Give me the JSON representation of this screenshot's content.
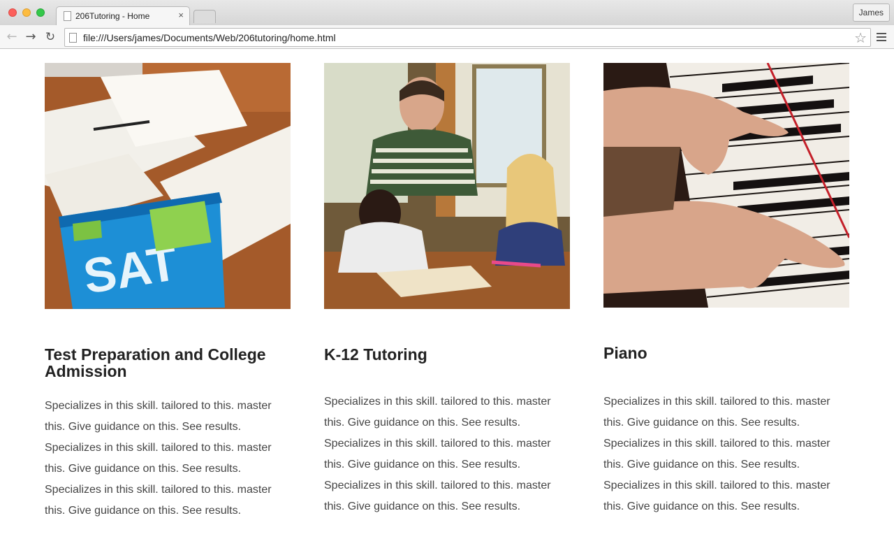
{
  "browser": {
    "tab_title": "206Tutoring - Home",
    "tab_close": "×",
    "profile_name": "James",
    "url": "file:///Users/james/Documents/Web/206tutoring/home.html",
    "back_icon": "←",
    "forward_icon": "→",
    "reload_icon": "↻",
    "star_icon": "☆"
  },
  "cards": [
    {
      "title": "Test Preparation and College Admission",
      "photo": "sat-study-guide-photo",
      "book_text": "SAT",
      "description": "Specializes in this skill. tailored to this. master this. Give guidance on this. See results. Specializes in this skill. tailored to this. master this. Give guidance on this. See results. Specializes in this skill. tailored to this. master this. Give guidance on this. See results."
    },
    {
      "title": "K-12 Tutoring",
      "photo": "tutor-with-children-photo",
      "description": "Specializes in this skill. tailored to this. master this. Give guidance on this. See results. Specializes in this skill. tailored to this. master this. Give guidance on this. See results. Specializes in this skill. tailored to this. master this. Give guidance on this. See results."
    },
    {
      "title": "Piano",
      "photo": "hands-on-piano-photo",
      "description": "Specializes in this skill. tailored to this. master this. Give guidance on this. See results. Specializes in this skill. tailored to this. master this. Give guidance on this. See results. Specializes in this skill. tailored to this. master this. Give guidance on this. See results."
    }
  ]
}
